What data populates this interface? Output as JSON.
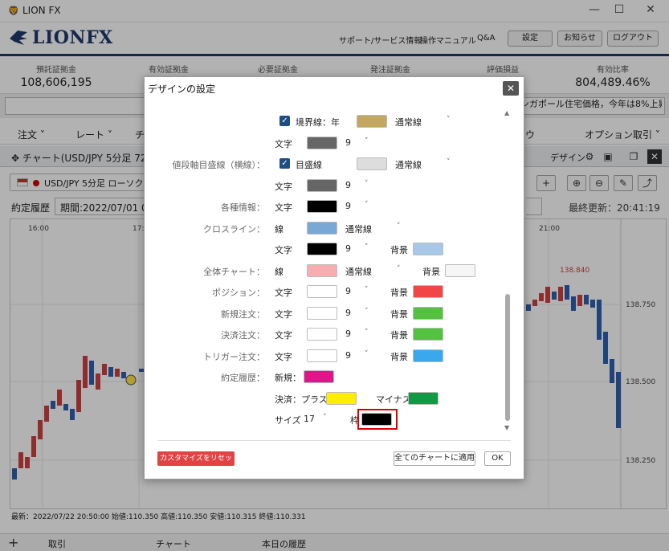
{
  "window": {
    "app_name": "LION FX",
    "minimize": "—",
    "maximize": "☐",
    "close": "✕"
  },
  "header": {
    "logo_text": "LIONFX",
    "links": [
      "サポート/サービス情報",
      "操作マニュアル",
      "Q&A"
    ],
    "buttons": [
      "設定",
      "お知らせ",
      "ログアウト"
    ]
  },
  "summary": {
    "items": [
      {
        "label": "預託証拠金",
        "value": "108,606,195"
      },
      {
        "label": "有効証拠金",
        "value": "1"
      },
      {
        "label": "必要証拠金",
        "value": ""
      },
      {
        "label": "発注証拠金",
        "value": ""
      },
      {
        "label": "評価損益",
        "value": ""
      },
      {
        "label": "有効比率",
        "value": "804,489.46%"
      }
    ]
  },
  "ticker": {
    "text": "ンガポール住宅価格，今年は8%上昇の見込"
  },
  "menu": {
    "items": [
      "注文",
      "レート",
      "チ",
      "ウ",
      "オプション取引"
    ]
  },
  "chart_window": {
    "title": "チャート(USD/JPY 5分足 72本",
    "design_label": "デザイン",
    "symbol": "USD/JPY 5分足 ローソク BID",
    "period_label": "約定履歴",
    "period_value": "期間:2022/07/01 0",
    "last_update": "最終更新：20:41:19",
    "footer": "最新：2022/07/22 20:50:00 始値:110.350 高値:110.350 安値:110.315 終値:110.331",
    "axis_x": [
      "16:00",
      "17:0",
      "21:00"
    ],
    "axis_y": [
      "138.750",
      "138.500",
      "138.250"
    ],
    "high_marker": "138.840",
    "tool_buttons": [
      "+",
      "⊕",
      "⊖",
      "✎",
      "⤴"
    ]
  },
  "bottom_tabs": {
    "plus": "+",
    "tabs": [
      "取引",
      "チャート",
      "本日の履歴"
    ]
  },
  "dialog": {
    "title": "デザインの設定",
    "close": "✕",
    "rows": {
      "boundary": {
        "label": "境界線：年",
        "style": "通常線",
        "color": "#c3a75e"
      },
      "boundary_text": {
        "label": "文字",
        "size": "9",
        "color": "#666666"
      },
      "price_grid": {
        "label": "値段軸目盛線（横線）：",
        "checkbox_label": "目盛線",
        "style": "通常線",
        "color": "#dddddd"
      },
      "price_grid_text": {
        "label": "文字",
        "size": "9",
        "color": "#666666"
      },
      "info": {
        "label": "各種情報：",
        "text_label": "文字",
        "size": "9",
        "color": "#000000"
      },
      "crossline": {
        "label": "クロスライン：",
        "line_label": "線",
        "style": "通常線",
        "color": "#79a7d6"
      },
      "crossline_text": {
        "label": "文字",
        "size": "9",
        "color": "#000000",
        "bg_label": "背景",
        "bg_color": "#a8c8e8"
      },
      "whole_chart": {
        "label": "全体チャート：",
        "line_label": "線",
        "style": "通常線",
        "color": "#f8aeb1",
        "bg_label": "背景",
        "bg_color": "#f6f6f6"
      },
      "position": {
        "label": "ポジション：",
        "text_label": "文字",
        "size": "9",
        "color": "#ffffff",
        "bg_label": "背景",
        "bg_color": "#f04646"
      },
      "new_order": {
        "label": "新規注文：",
        "text_label": "文字",
        "size": "9",
        "color": "#ffffff",
        "bg_label": "背景",
        "bg_color": "#52c23f"
      },
      "settle_order": {
        "label": "決済注文：",
        "text_label": "文字",
        "size": "9",
        "color": "#ffffff",
        "bg_label": "背景",
        "bg_color": "#52c23f"
      },
      "trigger_order": {
        "label": "トリガー注文：",
        "text_label": "文字",
        "size": "9",
        "color": "#ffffff",
        "bg_label": "背景",
        "bg_color": "#3aa8ec"
      },
      "execution": {
        "label": "約定履歴：",
        "new_label": "新規：",
        "new_color": "#e0158a"
      },
      "execution_settle": {
        "settle_label": "決済：プラス",
        "plus_color": "#ffee00",
        "minus_label": "マイナス",
        "minus_color": "#119944"
      },
      "execution_size": {
        "size_label": "サイズ",
        "size": "17",
        "frame_label": "枠",
        "frame_color": "#000000"
      }
    },
    "buttons": {
      "reset": "カスタマイズをリセット",
      "apply_all": "全てのチャートに適用",
      "ok": "OK"
    }
  }
}
